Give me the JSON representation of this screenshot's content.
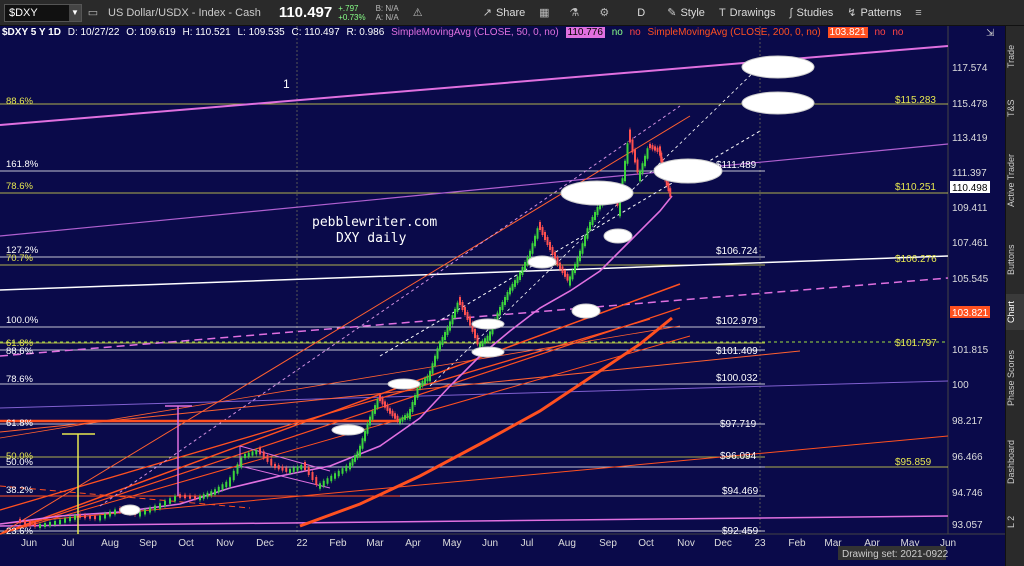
{
  "toolbar": {
    "symbol": "$DXY",
    "description": "US Dollar/USDX - Index - Cash",
    "last": "110.497",
    "change": "+.797",
    "change_pct": "+0.73%",
    "bid": "B: N/A",
    "ask": "A: N/A",
    "share": "Share",
    "period": "D",
    "style": "Style",
    "drawings": "Drawings",
    "studies": "Studies",
    "patterns": "Patterns"
  },
  "header": {
    "symbol_period": "$DXY 5 Y 1D",
    "date": "D: 10/27/22",
    "open": "O: 109.619",
    "high": "H: 110.521",
    "low": "L: 109.535",
    "close": "C: 110.497",
    "range": "R: 0.986",
    "sma50": "SimpleMovingAvg (CLOSE, 50, 0, no)",
    "sma50_val": "110.776",
    "sma200": "SimpleMovingAvg (CLOSE, 200, 0, no)",
    "sma200_val": "103.821",
    "no": "no"
  },
  "annotation": {
    "line1": "pebblewriter.com",
    "line2": "DXY daily",
    "wave": "1"
  },
  "price_axis": [
    "117.574",
    "115.478",
    "113.419",
    "111.397",
    "109.411",
    "107.461",
    "105.545",
    "103.665",
    "101.815",
    "100",
    "98.217",
    "96.466",
    "94.746",
    "93.057"
  ],
  "price_badges": {
    "last": "110.498",
    "sma200": "103.821"
  },
  "fib_left": [
    {
      "label": "88.6%",
      "color": "#e8e850"
    },
    {
      "label": "161.8%",
      "color": "#ffffff"
    },
    {
      "label": "78.6%",
      "color": "#e8e850"
    },
    {
      "label": "127.2%",
      "color": "#ffffff"
    },
    {
      "label": "70.7%",
      "color": "#e8e850"
    },
    {
      "label": "100.0%",
      "color": "#ffffff"
    },
    {
      "label": "61.8%",
      "color": "#e8e850"
    },
    {
      "label": "88.6%",
      "color": "#ffffff"
    },
    {
      "label": "78.6%",
      "color": "#ffffff"
    },
    {
      "label": "61.8%",
      "color": "#ffffff"
    },
    {
      "label": "50.0%",
      "color": "#e8e850"
    },
    {
      "label": "50.0%",
      "color": "#ffffff"
    },
    {
      "label": "38.2%",
      "color": "#ffffff"
    },
    {
      "label": "23.6%",
      "color": "#ffffff"
    }
  ],
  "fib_right": [
    {
      "label": "$115.283",
      "color": "#e8e850"
    },
    {
      "label": "$111.489",
      "color": "#ffffff"
    },
    {
      "label": "$110.251",
      "color": "#e8e850"
    },
    {
      "label": "$106.724",
      "color": "#ffffff"
    },
    {
      "label": "$106.276",
      "color": "#e8e850"
    },
    {
      "label": "$102.979",
      "color": "#ffffff"
    },
    {
      "label": "$101.797",
      "color": "#e8e850"
    },
    {
      "label": "$101.409",
      "color": "#ffffff"
    },
    {
      "label": "$100.032",
      "color": "#ffffff"
    },
    {
      "label": "$97.719",
      "color": "#ffffff"
    },
    {
      "label": "$96.094",
      "color": "#ffffff"
    },
    {
      "label": "$95.859",
      "color": "#e8e850"
    },
    {
      "label": "$94.469",
      "color": "#ffffff"
    },
    {
      "label": "$92.459",
      "color": "#ffffff"
    }
  ],
  "time_axis": [
    "Jun",
    "Jul",
    "Aug",
    "Sep",
    "Oct",
    "Nov",
    "Dec",
    "22",
    "Feb",
    "Mar",
    "Apr",
    "May",
    "Jun",
    "Jul",
    "Aug",
    "Sep",
    "Oct",
    "Nov",
    "Dec",
    "23",
    "Feb",
    "Mar",
    "Apr",
    "May",
    "Jun"
  ],
  "drawing_set": "Drawing set: 2021-0922",
  "side_tabs": [
    "Trade",
    "T&S",
    "Active Trader",
    "Buttons",
    "Chart",
    "Phase Scores",
    "Dashboard",
    "L 2"
  ],
  "colors": {
    "background": "#0a0a4a",
    "yellow": "#e8e850",
    "magenta": "#e070e0",
    "orange": "#ff5020"
  }
}
